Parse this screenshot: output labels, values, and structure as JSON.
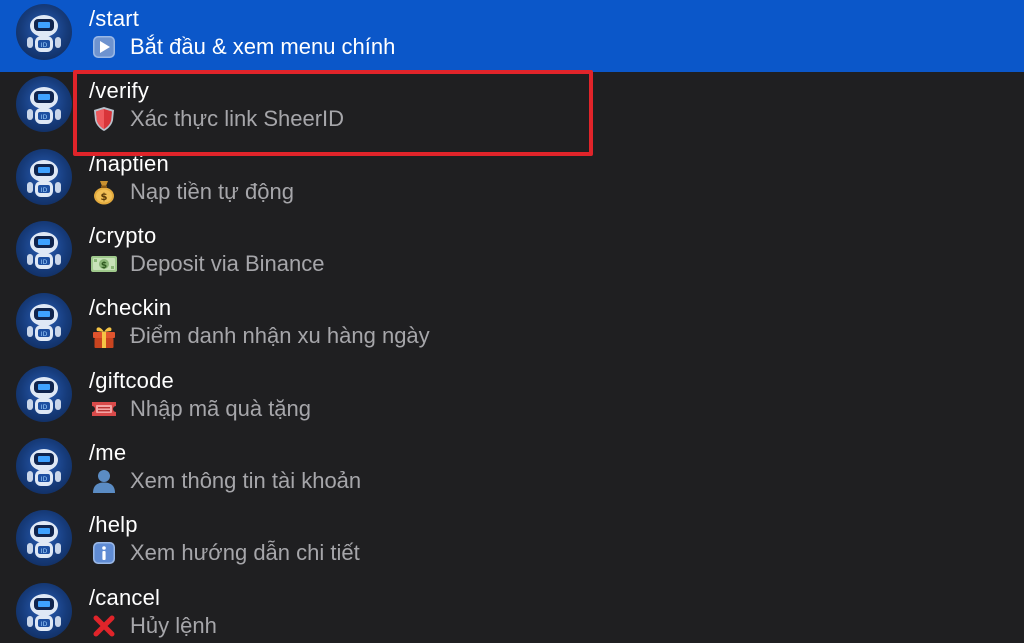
{
  "commands": [
    {
      "command": "/start",
      "emoji": "play-button-icon",
      "description": "Bắt đầu & xem menu chính",
      "selected": true
    },
    {
      "command": "/verify",
      "emoji": "shield-icon",
      "description": "Xác thực link SheerID",
      "selected": false
    },
    {
      "command": "/naptien",
      "emoji": "money-bag-icon",
      "description": "Nạp tiền tự động",
      "selected": false
    },
    {
      "command": "/crypto",
      "emoji": "dollar-banknote-icon",
      "description": "Deposit via Binance",
      "selected": false
    },
    {
      "command": "/checkin",
      "emoji": "gift-icon",
      "description": "Điểm danh nhận xu hàng ngày",
      "selected": false
    },
    {
      "command": "/giftcode",
      "emoji": "ticket-icon",
      "description": "Nhập mã quà tặng",
      "selected": false
    },
    {
      "command": "/me",
      "emoji": "person-icon",
      "description": "Xem thông tin tài khoản",
      "selected": false
    },
    {
      "command": "/help",
      "emoji": "info-icon",
      "description": "Xem hướng dẫn chi tiết",
      "selected": false
    },
    {
      "command": "/cancel",
      "emoji": "cross-mark-icon",
      "description": "Hủy lệnh",
      "selected": false
    }
  ],
  "colors": {
    "background": "#1f1f21",
    "selected": "#0b57c9",
    "highlight": "#e0242a"
  }
}
